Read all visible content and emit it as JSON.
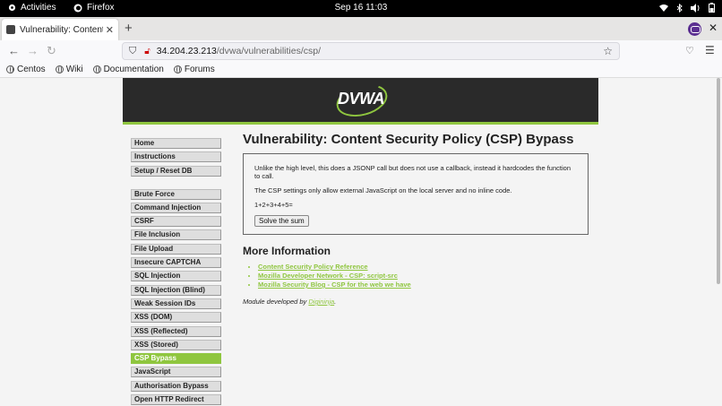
{
  "topbar": {
    "activities": "Activities",
    "app_name": "Firefox",
    "clock": "Sep 16  11:03",
    "tray_icons": [
      "network-icon",
      "bluetooth-icon",
      "volume-icon",
      "battery-icon"
    ]
  },
  "browser": {
    "tab_title": "Vulnerability: Content Se",
    "url_host": "34.204.23.213",
    "url_path": "/dvwa/vulnerabilities/csp/",
    "bookmarks": [
      "Centos",
      "Wiki",
      "Documentation",
      "Forums"
    ]
  },
  "dvwa": {
    "logo_text": "DVWA",
    "menu_group1": [
      "Home",
      "Instructions",
      "Setup / Reset DB"
    ],
    "menu_group2": [
      "Brute Force",
      "Command Injection",
      "CSRF",
      "File Inclusion",
      "File Upload",
      "Insecure CAPTCHA",
      "SQL Injection",
      "SQL Injection (Blind)",
      "Weak Session IDs",
      "XSS (DOM)",
      "XSS (Reflected)",
      "XSS (Stored)",
      "CSP Bypass",
      "JavaScript",
      "Authorisation Bypass",
      "Open HTTP Redirect"
    ],
    "active_item": "CSP Bypass",
    "accent_color": "#8fc63f"
  },
  "main": {
    "title": "Vulnerability: Content Security Policy (CSP) Bypass",
    "para1": "Unlike the high level, this does a JSONP call but does not use a callback, instead it hardcodes the function to call.",
    "para2": "The CSP settings only allow external JavaScript on the local server and no inline code.",
    "equation": "1+2+3+4+5=",
    "button": "Solve the sum",
    "more_info_heading": "More Information",
    "links": [
      "Content Security Policy Reference",
      "Mozilla Developer Network - CSP: script-src",
      "Mozilla Security Blog - CSP for the web we have"
    ],
    "credit_prefix": "Module developed by ",
    "credit_author": "Digininja",
    "credit_suffix": "."
  }
}
